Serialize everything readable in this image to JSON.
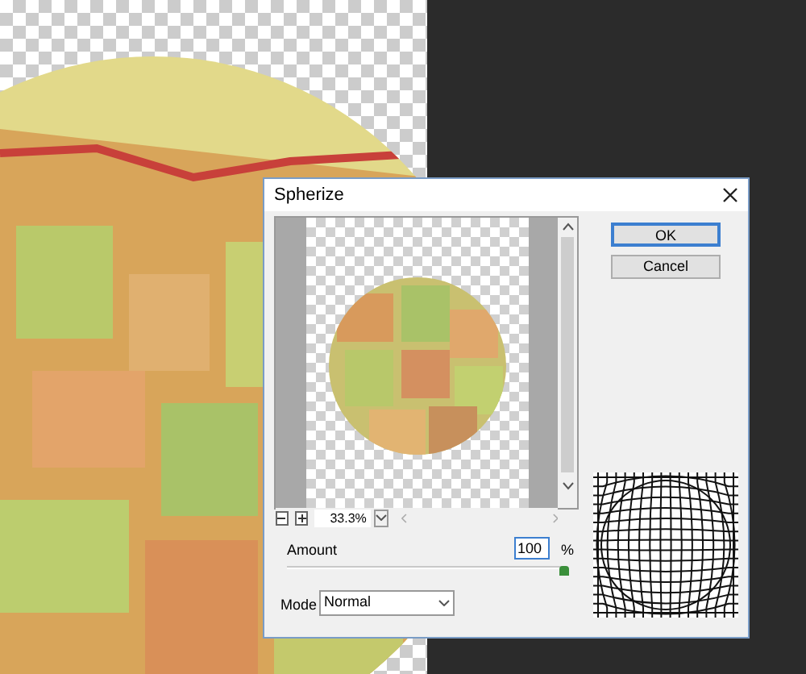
{
  "dialog": {
    "title": "Spherize"
  },
  "buttons": [
    {
      "label": "OK",
      "default": true
    },
    {
      "label": "Cancel",
      "default": false
    }
  ],
  "zoom": {
    "value": "33.3%"
  },
  "amount": {
    "label": "Amount",
    "value": "100",
    "unit": "%",
    "level": 1
  },
  "mode": {
    "label": "Mode",
    "value": "Normal"
  }
}
